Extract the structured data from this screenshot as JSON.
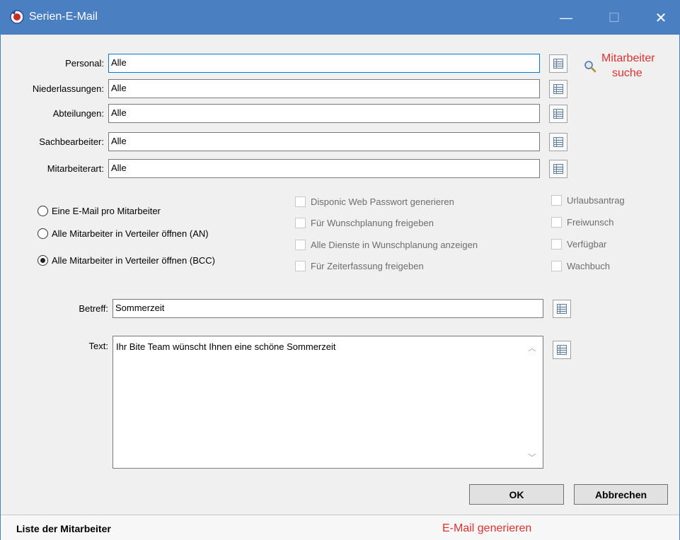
{
  "window": {
    "title": "Serien-E-Mail",
    "controls": {
      "minimize": "—",
      "maximize": "☐",
      "close": "✕"
    }
  },
  "filters": [
    {
      "label": "Personal:",
      "value": "Alle"
    },
    {
      "label": "Niederlassungen:",
      "value": "Alle"
    },
    {
      "label": "Abteilungen:",
      "value": "Alle"
    },
    {
      "label": "Sachbearbeiter:",
      "value": "Alle"
    },
    {
      "label": "Mitarbeiterart:",
      "value": "Alle"
    }
  ],
  "annotations": {
    "search_line1": "Mitarbeiter",
    "search_line2": "suche",
    "generate": "E-Mail generieren"
  },
  "radios": [
    {
      "label": "Eine E-Mail pro Mitarbeiter",
      "checked": false
    },
    {
      "label": "Alle Mitarbeiter in Verteiler öffnen (AN)",
      "checked": false
    },
    {
      "label": "Alle Mitarbeiter in Verteiler öffnen (BCC)",
      "checked": true
    }
  ],
  "options_middle": [
    "Disponic Web Passwort generieren",
    "Für Wunschplanung freigeben",
    "Alle Dienste in Wunschplanung anzeigen",
    "Für Zeiterfassung freigeben"
  ],
  "options_right": [
    "Urlaubsantrag",
    "Freiwunsch",
    "Verfügbar",
    "Wachbuch"
  ],
  "betreff": {
    "label": "Betreff:",
    "value": "Sommerzeit"
  },
  "text": {
    "label": "Text:",
    "value": "Ihr Bite Team wünscht Ihnen eine schöne Sommerzeit"
  },
  "buttons": {
    "ok": "OK",
    "cancel": "Abbrechen"
  },
  "statusbar": {
    "text": "Liste der Mitarbeiter"
  },
  "colors": {
    "titlebar": "#4a7fc1",
    "annotation": "#e03030"
  }
}
